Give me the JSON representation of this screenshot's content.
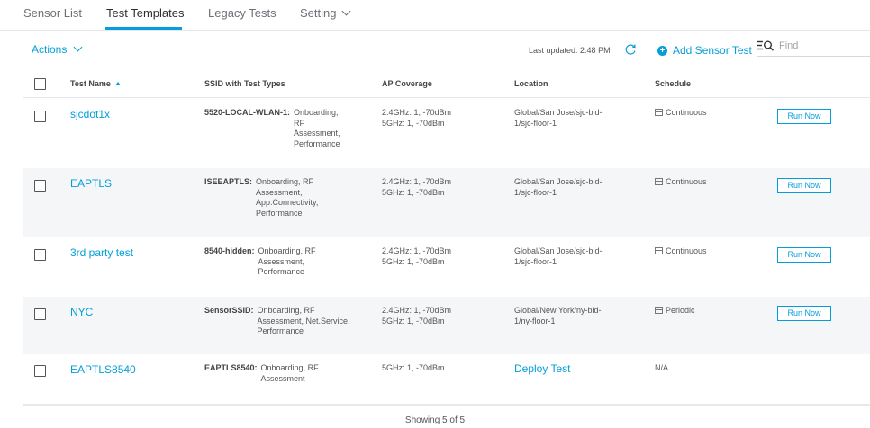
{
  "tabs": [
    "Sensor List",
    "Test Templates",
    "Legacy Tests",
    "Setting"
  ],
  "toolbar": {
    "actions_label": "Actions",
    "last_updated": "Last updated: 2:48 PM",
    "add_label": "Add Sensor Test",
    "find_placeholder": "Find"
  },
  "table": {
    "columns": [
      "Test Name",
      "SSID with Test Types",
      "AP Coverage",
      "Location",
      "Schedule"
    ],
    "sort": {
      "column": "Test Name",
      "direction": "ascending"
    },
    "rows": [
      {
        "name": "sjcdot1x",
        "ssid_key": "5520-LOCAL-WLAN-1:",
        "ssid_types": [
          "Onboarding,",
          "RF",
          "Assessment,",
          "Performance"
        ],
        "coverage": [
          "2.4GHz: 1, -70dBm",
          "5GHz: 1, -70dBm"
        ],
        "location": [
          "Global/San Jose/sjc-bld-",
          "1/sjc-floor-1"
        ],
        "schedule": "Continuous",
        "action": "Run Now"
      },
      {
        "name": "EAPTLS",
        "ssid_key": "ISEEAPTLS:",
        "ssid_types": [
          "Onboarding, RF",
          "Assessment,",
          "App.Connectivity,",
          "Performance"
        ],
        "coverage": [
          "2.4GHz: 1, -70dBm",
          "5GHz: 1, -70dBm"
        ],
        "location": [
          "Global/San Jose/sjc-bld-",
          "1/sjc-floor-1"
        ],
        "schedule": "Continuous",
        "action": "Run Now"
      },
      {
        "name": "3rd party test",
        "ssid_key": "8540-hidden:",
        "ssid_types": [
          "Onboarding, RF",
          "Assessment,",
          "Performance"
        ],
        "coverage": [
          "2.4GHz: 1, -70dBm",
          "5GHz: 1, -70dBm"
        ],
        "location": [
          "Global/San Jose/sjc-bld-",
          "1/sjc-floor-1"
        ],
        "schedule": "Continuous",
        "action": "Run Now"
      },
      {
        "name": "NYC",
        "ssid_key": "SensorSSID:",
        "ssid_types": [
          "Onboarding, RF",
          "Assessment, Net.Service,",
          "Performance"
        ],
        "coverage": [
          "2.4GHz: 1, -70dBm",
          "5GHz: 1, -70dBm"
        ],
        "location": [
          "Global/New York/ny-bld-",
          "1/ny-floor-1"
        ],
        "schedule": "Periodic",
        "action": "Run Now"
      },
      {
        "name": "EAPTLS8540",
        "ssid_key": "EAPTLS8540:",
        "ssid_types": [
          "Onboarding, RF",
          "Assessment"
        ],
        "coverage": [
          "5GHz: 1, -70dBm"
        ],
        "location_action": "Deploy Test",
        "schedule_text": "N/A"
      }
    ]
  },
  "footer": {
    "showing": "Showing 5 of 5"
  },
  "colors": {
    "accent": "#049fd9",
    "row_alt": "#f5f6f7",
    "text": "#555555"
  }
}
